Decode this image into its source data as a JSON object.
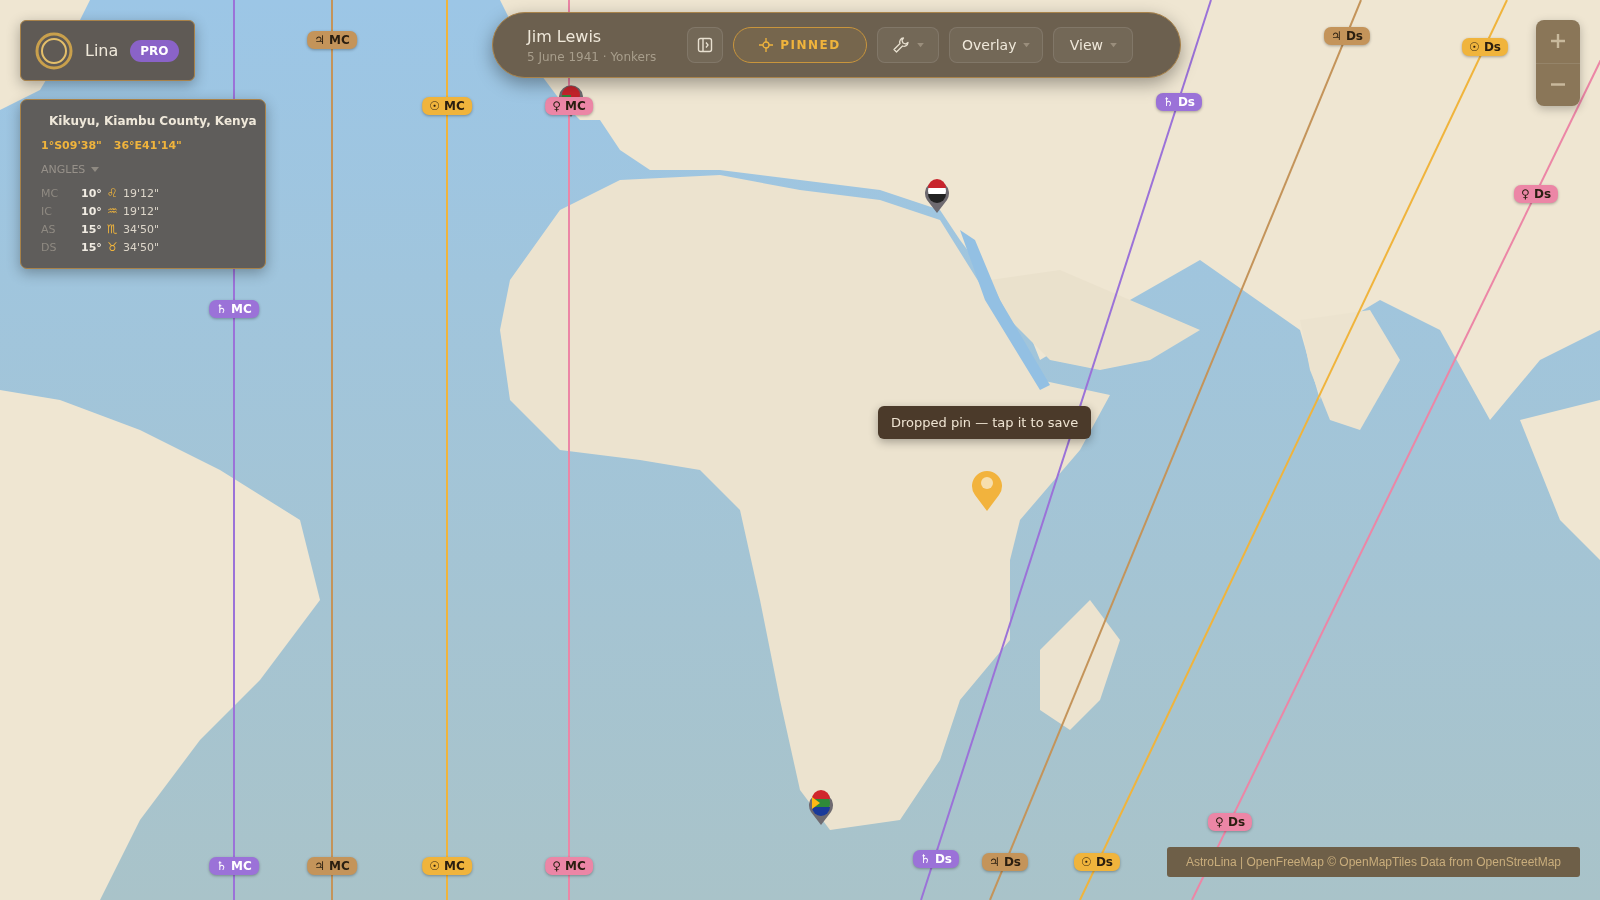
{
  "user": {
    "name": "Lina",
    "badge": "PRO"
  },
  "location": {
    "place": "Kikuyu, Kiambu County, Kenya",
    "latitude": "1°S09'38\"",
    "longitude": "36°E41'14\"",
    "section": "ANGLES",
    "angles": [
      {
        "label": "MC",
        "degree": "10°",
        "sign": "♌",
        "minutes": "19'12\""
      },
      {
        "label": "IC",
        "degree": "10°",
        "sign": "♒",
        "minutes": "19'12\""
      },
      {
        "label": "AS",
        "degree": "15°",
        "sign": "♏",
        "minutes": "34'50\""
      },
      {
        "label": "DS",
        "degree": "15°",
        "sign": "♉",
        "minutes": "34'50\""
      }
    ]
  },
  "chart": {
    "name": "Jim Lewis",
    "details": "5 June 1941 · Yonkers"
  },
  "pinned": {
    "label": "PINNED",
    "on": true
  },
  "menus": [
    "Overlay",
    "View"
  ],
  "lines": [
    {
      "kind": "mc",
      "color": "#9b72d8",
      "labels": [
        "♄ MC",
        "♄ MC"
      ]
    },
    {
      "kind": "mc",
      "color": "#c4945a",
      "labels": [
        "♃ MC",
        "♃ MC"
      ]
    },
    {
      "kind": "mc",
      "color": "#f0b43c",
      "labels": [
        "☉ MC",
        "☉ MC"
      ]
    },
    {
      "kind": "mc",
      "color": "#ec86a6",
      "labels": [
        "♀ MC",
        "♀ MC"
      ]
    },
    {
      "kind": "ds",
      "color": "#9b72d8",
      "labels": [
        "♄ Ds",
        "♄ Ds"
      ]
    },
    {
      "kind": "ds",
      "color": "#c4945a",
      "labels": [
        "♃ Ds",
        "♃ Ds"
      ]
    },
    {
      "kind": "ds",
      "color": "#f0b43c",
      "labels": [
        "☉ Ds",
        "☉ Ds"
      ]
    },
    {
      "kind": "ds",
      "color": "#ec86a6",
      "labels": [
        "♀ Ds",
        "♀ Ds"
      ]
    }
  ],
  "tooltip": "Dropped pin — tap it to save",
  "attribution": "AstroLina | OpenFreeMap © OpenMapTiles Data from OpenStreetMap"
}
